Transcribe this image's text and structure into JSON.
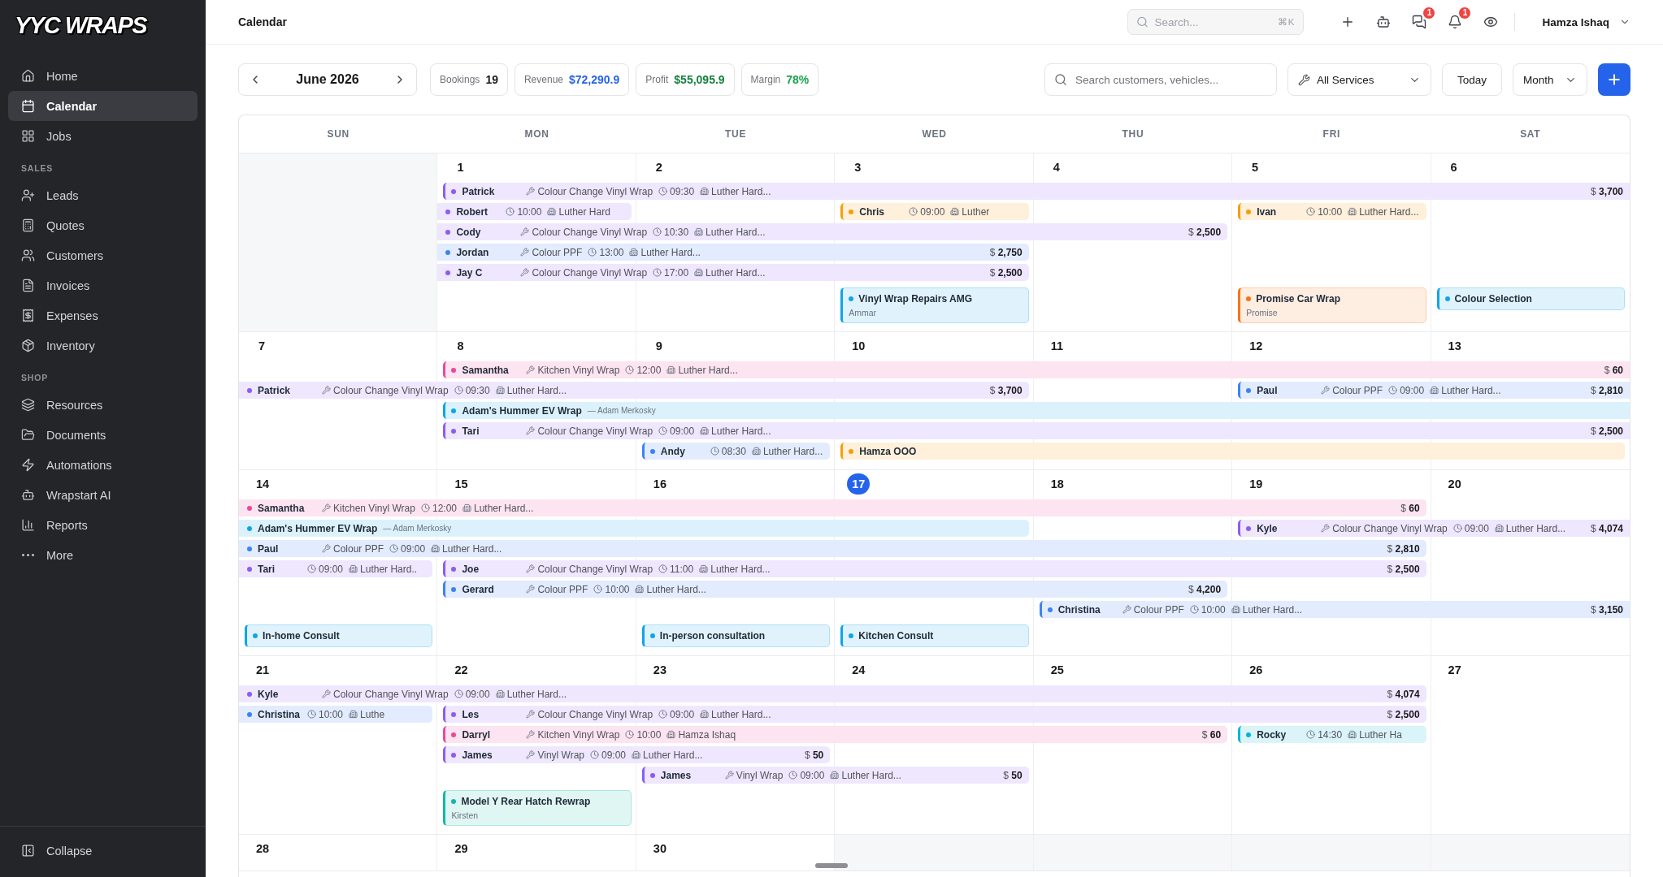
{
  "sidebar": {
    "logo": "YYC WRAPS",
    "sections": [
      {
        "items": [
          {
            "label": "Home",
            "selected": false
          },
          {
            "label": "Calendar",
            "selected": true
          },
          {
            "label": "Jobs",
            "selected": false
          }
        ]
      },
      {
        "title": "SALES",
        "items": [
          {
            "label": "Leads",
            "selected": false
          },
          {
            "label": "Quotes",
            "selected": false
          },
          {
            "label": "Customers",
            "selected": false
          },
          {
            "label": "Invoices",
            "selected": false
          },
          {
            "label": "Expenses",
            "selected": false
          },
          {
            "label": "Inventory",
            "selected": false
          }
        ]
      },
      {
        "title": "SHOP",
        "items": [
          {
            "label": "Resources",
            "selected": false
          },
          {
            "label": "Documents",
            "selected": false
          },
          {
            "label": "Automations",
            "selected": false
          },
          {
            "label": "Wrapstart AI",
            "selected": false
          },
          {
            "label": "Reports",
            "selected": false
          },
          {
            "label": "More",
            "selected": false
          }
        ]
      }
    ],
    "footer": {
      "label": "Collapse"
    }
  },
  "topbar": {
    "title": "Calendar",
    "search": {
      "placeholder": "Search...",
      "shortcut": "⌘K"
    },
    "messages_badge": "1",
    "notifications_badge": "1",
    "user": "Hamza Ishaq"
  },
  "toolbar": {
    "month": "June 2026",
    "stats": [
      {
        "label": "Bookings",
        "value": "19",
        "color": "#18181b"
      },
      {
        "label": "Revenue",
        "value": "$72,290.9",
        "color": "#2563eb"
      },
      {
        "label": "Profit",
        "value": "$55,095.9",
        "color": "#15803d"
      },
      {
        "label": "Margin",
        "value": "78%",
        "color": "#16a34a"
      }
    ],
    "search": {
      "placeholder": "Search customers, vehicles..."
    },
    "service_filter": "All Services",
    "today_button": "Today",
    "view": "Month"
  },
  "calendar": {
    "weekdays": [
      "SUN",
      "MON",
      "TUE",
      "WED",
      "THU",
      "FRI",
      "SAT"
    ],
    "weeks": [
      {
        "days": [
          {
            "kind": "outside"
          },
          {
            "kind": "day",
            "date": "1",
            "today": false
          },
          {
            "kind": "day",
            "date": "2",
            "today": false
          },
          {
            "kind": "day",
            "date": "3",
            "today": false,
            "cards": [
              {
                "title": "Vinyl Wrap Repairs AMG",
                "subtitle": "Ammar",
                "color": "#0ea5e9"
              }
            ]
          },
          {
            "kind": "day",
            "date": "4",
            "today": false
          },
          {
            "kind": "day",
            "date": "5",
            "today": false,
            "cards": [
              {
                "title": "Promise Car Wrap",
                "subtitle": "Promise",
                "color": "#f97316"
              }
            ]
          },
          {
            "kind": "day",
            "date": "6",
            "today": false,
            "cards": [
              {
                "title": "Colour Selection",
                "color": "#0ea5e9"
              }
            ]
          }
        ],
        "lanes": [
          {
            "slots": [
              {
                "kind": "empty"
              },
              {
                "kind": "booking",
                "name": "Patrick",
                "color": "#8b5cf6",
                "from_previous_week": false,
                "to_next_week": true,
                "service": "Colour Change Vinyl Wrap",
                "time": "09:30",
                "location": "Luther Hard...",
                "amount": "$ **3,700**"
              },
              {
                "kind": "continued"
              },
              {
                "kind": "continued"
              },
              {
                "kind": "continued"
              },
              {
                "kind": "continued"
              },
              {
                "kind": "continued"
              }
            ]
          },
          {
            "slots": [
              {
                "kind": "empty"
              },
              {
                "kind": "booking",
                "name": "Robert",
                "color": "#8b5cf6",
                "from_previous_week": true,
                "to_next_week": false,
                "time": "10:00",
                "location": "Luther Hard"
              },
              {
                "kind": "empty"
              },
              {
                "kind": "booking",
                "name": "Chris",
                "color": "#f59e0b",
                "from_previous_week": false,
                "to_next_week": false,
                "time": "09:00",
                "location": "Luther"
              },
              {
                "kind": "empty"
              },
              {
                "kind": "booking",
                "name": "Ivan",
                "color": "#f59e0b",
                "from_previous_week": false,
                "to_next_week": false,
                "time": "10:00",
                "location": "Luther Hard..."
              },
              {
                "kind": "empty"
              }
            ]
          },
          {
            "slots": [
              {
                "kind": "empty"
              },
              {
                "kind": "booking",
                "name": "Cody",
                "color": "#8b5cf6",
                "from_previous_week": true,
                "to_next_week": false,
                "service": "Colour Change Vinyl Wrap",
                "time": "10:30",
                "location": "Luther Hard...",
                "amount": "$ **2,500**"
              },
              {
                "kind": "continued"
              },
              {
                "kind": "continued"
              },
              {
                "kind": "continued"
              },
              {
                "kind": "empty"
              },
              {
                "kind": "empty"
              }
            ]
          },
          {
            "slots": [
              {
                "kind": "empty"
              },
              {
                "kind": "booking",
                "name": "Jordan",
                "color": "#3b82f6",
                "from_previous_week": true,
                "to_next_week": false,
                "service": "Colour PPF",
                "time": "13:00",
                "location": "Luther Hard...",
                "amount": "$ **2,750**"
              },
              {
                "kind": "continued"
              },
              {
                "kind": "continued"
              },
              {
                "kind": "empty"
              },
              {
                "kind": "empty"
              },
              {
                "kind": "empty"
              }
            ]
          },
          {
            "slots": [
              {
                "kind": "empty"
              },
              {
                "kind": "booking",
                "name": "Jay C",
                "color": "#8b5cf6",
                "from_previous_week": true,
                "to_next_week": false,
                "service": "Colour Change Vinyl Wrap",
                "time": "17:00",
                "location": "Luther Hard...",
                "amount": "$ **2,500**"
              },
              {
                "kind": "continued"
              },
              {
                "kind": "continued"
              },
              {
                "kind": "empty"
              },
              {
                "kind": "empty"
              },
              {
                "kind": "empty"
              }
            ]
          }
        ]
      },
      {
        "days": [
          {
            "kind": "day",
            "date": "7",
            "today": false
          },
          {
            "kind": "day",
            "date": "8",
            "today": false
          },
          {
            "kind": "day",
            "date": "9",
            "today": false
          },
          {
            "kind": "day",
            "date": "10",
            "today": false
          },
          {
            "kind": "day",
            "date": "11",
            "today": false
          },
          {
            "kind": "day",
            "date": "12",
            "today": false
          },
          {
            "kind": "day",
            "date": "13",
            "today": false
          }
        ],
        "lanes": [
          {
            "slots": [
              {
                "kind": "empty"
              },
              {
                "kind": "booking",
                "name": "Samantha",
                "color": "#ec4899",
                "from_previous_week": false,
                "to_next_week": true,
                "service": "Kitchen Vinyl Wrap",
                "time": "12:00",
                "location": "Luther Hard...",
                "amount": "$ **60**"
              },
              {
                "kind": "continued"
              },
              {
                "kind": "continued"
              },
              {
                "kind": "continued"
              },
              {
                "kind": "continued"
              },
              {
                "kind": "continued"
              }
            ]
          },
          {
            "slots": [
              {
                "kind": "booking",
                "name": "Patrick",
                "color": "#8b5cf6",
                "from_previous_week": true,
                "to_next_week": false,
                "service": "Colour Change Vinyl Wrap",
                "time": "09:30",
                "location": "Luther Hard...",
                "amount": "$ **3,700**"
              },
              {
                "kind": "continued"
              },
              {
                "kind": "continued"
              },
              {
                "kind": "continued"
              },
              {
                "kind": "empty"
              },
              {
                "kind": "booking",
                "name": "Paul",
                "color": "#3b82f6",
                "from_previous_week": false,
                "to_next_week": true,
                "service": "Colour PPF",
                "time": "09:00",
                "location": "Luther Hard...",
                "amount": "$ **2,810**"
              },
              {
                "kind": "continued"
              }
            ]
          },
          {
            "slots": [
              {
                "kind": "empty"
              },
              {
                "kind": "project",
                "name": "Adam's Hummer EV Wrap",
                "note": "— Adam Merkosky",
                "color": "#0ea5e9",
                "from_previous_week": false,
                "to_next_week": true
              },
              {
                "kind": "continued"
              },
              {
                "kind": "continued"
              },
              {
                "kind": "continued"
              },
              {
                "kind": "continued"
              },
              {
                "kind": "continued"
              }
            ]
          },
          {
            "slots": [
              {
                "kind": "empty"
              },
              {
                "kind": "booking",
                "name": "Tari",
                "color": "#8b5cf6",
                "from_previous_week": false,
                "to_next_week": true,
                "service": "Colour Change Vinyl Wrap",
                "time": "09:00",
                "location": "Luther Hard...",
                "amount": "$ **2,500**"
              },
              {
                "kind": "continued"
              },
              {
                "kind": "continued"
              },
              {
                "kind": "continued"
              },
              {
                "kind": "continued"
              },
              {
                "kind": "continued"
              }
            ]
          },
          {
            "slots": [
              {
                "kind": "empty"
              },
              {
                "kind": "empty"
              },
              {
                "kind": "booking",
                "name": "Andy",
                "color": "#3b82f6",
                "from_previous_week": false,
                "to_next_week": false,
                "time": "08:30",
                "location": "Luther Hard..."
              },
              {
                "kind": "booking",
                "name": "Hamza OOO",
                "color": "#f59e0b",
                "from_previous_week": false,
                "to_next_week": false
              },
              {
                "kind": "continued"
              },
              {
                "kind": "continued"
              },
              {
                "kind": "continued"
              }
            ]
          }
        ]
      },
      {
        "days": [
          {
            "kind": "day",
            "date": "14",
            "today": false,
            "cards": [
              {
                "title": "In-home Consult",
                "color": "#0ea5e9"
              }
            ]
          },
          {
            "kind": "day",
            "date": "15",
            "today": false
          },
          {
            "kind": "day",
            "date": "16",
            "today": false,
            "cards": [
              {
                "title": "In-person consultation",
                "color": "#0ea5e9"
              }
            ]
          },
          {
            "kind": "day",
            "date": "17",
            "today": true,
            "cards": [
              {
                "title": "Kitchen Consult",
                "color": "#0ea5e9"
              }
            ]
          },
          {
            "kind": "day",
            "date": "18",
            "today": false
          },
          {
            "kind": "day",
            "date": "19",
            "today": false
          },
          {
            "kind": "day",
            "date": "20",
            "today": false
          }
        ],
        "lanes": [
          {
            "slots": [
              {
                "kind": "booking",
                "name": "Samantha",
                "color": "#ec4899",
                "from_previous_week": true,
                "to_next_week": false,
                "service": "Kitchen Vinyl Wrap",
                "time": "12:00",
                "location": "Luther Hard...",
                "amount": "$ **60**"
              },
              {
                "kind": "continued"
              },
              {
                "kind": "continued"
              },
              {
                "kind": "continued"
              },
              {
                "kind": "continued"
              },
              {
                "kind": "continued"
              },
              {
                "kind": "empty"
              }
            ]
          },
          {
            "slots": [
              {
                "kind": "project",
                "name": "Adam's Hummer EV Wrap",
                "note": "— Adam Merkosky",
                "color": "#0ea5e9",
                "from_previous_week": true,
                "to_next_week": false
              },
              {
                "kind": "continued"
              },
              {
                "kind": "continued"
              },
              {
                "kind": "continued"
              },
              {
                "kind": "empty"
              },
              {
                "kind": "booking",
                "name": "Kyle",
                "color": "#8b5cf6",
                "from_previous_week": false,
                "to_next_week": true,
                "service": "Colour Change Vinyl Wrap",
                "time": "09:00",
                "location": "Luther Hard...",
                "amount": "$ **4,074**"
              },
              {
                "kind": "continued"
              }
            ]
          },
          {
            "slots": [
              {
                "kind": "booking",
                "name": "Paul",
                "color": "#3b82f6",
                "from_previous_week": true,
                "to_next_week": false,
                "service": "Colour PPF",
                "time": "09:00",
                "location": "Luther Hard...",
                "amount": "$ **2,810**"
              },
              {
                "kind": "continued"
              },
              {
                "kind": "continued"
              },
              {
                "kind": "continued"
              },
              {
                "kind": "continued"
              },
              {
                "kind": "continued"
              },
              {
                "kind": "empty"
              }
            ]
          },
          {
            "slots": [
              {
                "kind": "booking",
                "name": "Tari",
                "color": "#8b5cf6",
                "from_previous_week": true,
                "to_next_week": false,
                "time": "09:00",
                "location": "Luther Hard.."
              },
              {
                "kind": "booking",
                "name": "Joe",
                "color": "#8b5cf6",
                "from_previous_week": false,
                "to_next_week": false,
                "service": "Colour Change Vinyl Wrap",
                "time": "11:00",
                "location": "Luther Hard...",
                "amount": "$ **2,500**"
              },
              {
                "kind": "continued"
              },
              {
                "kind": "continued"
              },
              {
                "kind": "continued"
              },
              {
                "kind": "continued"
              },
              {
                "kind": "empty"
              }
            ]
          },
          {
            "slots": [
              {
                "kind": "empty"
              },
              {
                "kind": "booking",
                "name": "Gerard",
                "color": "#3b82f6",
                "from_previous_week": false,
                "to_next_week": false,
                "service": "Colour PPF",
                "time": "10:00",
                "location": "Luther Hard...",
                "amount": "$ **4,200**"
              },
              {
                "kind": "continued"
              },
              {
                "kind": "continued"
              },
              {
                "kind": "continued"
              },
              {
                "kind": "empty"
              },
              {
                "kind": "empty"
              }
            ]
          },
          {
            "slots": [
              {
                "kind": "empty"
              },
              {
                "kind": "empty"
              },
              {
                "kind": "empty"
              },
              {
                "kind": "empty"
              },
              {
                "kind": "booking",
                "name": "Christina",
                "color": "#3b82f6",
                "from_previous_week": false,
                "to_next_week": true,
                "service": "Colour PPF",
                "time": "10:00",
                "location": "Luther Hard...",
                "amount": "$ **3,150**"
              },
              {
                "kind": "continued"
              },
              {
                "kind": "continued"
              }
            ]
          }
        ]
      },
      {
        "days": [
          {
            "kind": "day",
            "date": "21",
            "today": false
          },
          {
            "kind": "day",
            "date": "22",
            "today": false,
            "cards": [
              {
                "title": "Model Y Rear Hatch Rewrap",
                "subtitle": "Kirsten",
                "color": "#14b8a6"
              }
            ]
          },
          {
            "kind": "day",
            "date": "23",
            "today": false
          },
          {
            "kind": "day",
            "date": "24",
            "today": false
          },
          {
            "kind": "day",
            "date": "25",
            "today": false
          },
          {
            "kind": "day",
            "date": "26",
            "today": false
          },
          {
            "kind": "day",
            "date": "27",
            "today": false
          }
        ],
        "lanes": [
          {
            "slots": [
              {
                "kind": "booking",
                "name": "Kyle",
                "color": "#8b5cf6",
                "from_previous_week": true,
                "to_next_week": false,
                "service": "Colour Change Vinyl Wrap",
                "time": "09:00",
                "location": "Luther Hard...",
                "amount": "$ **4,074**"
              },
              {
                "kind": "continued"
              },
              {
                "kind": "continued"
              },
              {
                "kind": "continued"
              },
              {
                "kind": "continued"
              },
              {
                "kind": "continued"
              },
              {
                "kind": "empty"
              }
            ]
          },
          {
            "slots": [
              {
                "kind": "booking",
                "name": "Christina",
                "color": "#3b82f6",
                "from_previous_week": true,
                "to_next_week": false,
                "time": "10:00",
                "location": "Luthe"
              },
              {
                "kind": "booking",
                "name": "Les",
                "color": "#8b5cf6",
                "from_previous_week": false,
                "to_next_week": false,
                "service": "Colour Change Vinyl Wrap",
                "time": "09:00",
                "location": "Luther Hard...",
                "amount": "$ **2,500**"
              },
              {
                "kind": "continued"
              },
              {
                "kind": "continued"
              },
              {
                "kind": "continued"
              },
              {
                "kind": "continued"
              },
              {
                "kind": "empty"
              }
            ]
          },
          {
            "slots": [
              {
                "kind": "empty"
              },
              {
                "kind": "booking",
                "name": "Darryl",
                "color": "#ec4899",
                "from_previous_week": false,
                "to_next_week": false,
                "service": "Kitchen Vinyl Wrap",
                "time": "10:00",
                "location": "Hamza Ishaq",
                "amount": "$ **60**"
              },
              {
                "kind": "continued"
              },
              {
                "kind": "continued"
              },
              {
                "kind": "continued"
              },
              {
                "kind": "booking",
                "name": "Rocky",
                "color": "#06b6d4",
                "from_previous_week": false,
                "to_next_week": false,
                "time": "14:30",
                "location": "Luther Ha"
              },
              {
                "kind": "empty"
              }
            ]
          },
          {
            "slots": [
              {
                "kind": "empty"
              },
              {
                "kind": "booking",
                "name": "James",
                "color": "#8b5cf6",
                "from_previous_week": false,
                "to_next_week": false,
                "service": "Vinyl Wrap",
                "time": "09:00",
                "location": "Luther Hard...",
                "amount": "$ **50**"
              },
              {
                "kind": "continued"
              },
              {
                "kind": "empty"
              },
              {
                "kind": "empty"
              },
              {
                "kind": "empty"
              },
              {
                "kind": "empty"
              }
            ]
          },
          {
            "slots": [
              {
                "kind": "empty"
              },
              {
                "kind": "empty"
              },
              {
                "kind": "booking",
                "name": "James",
                "color": "#8b5cf6",
                "from_previous_week": false,
                "to_next_week": false,
                "service": "Vinyl Wrap",
                "time": "09:00",
                "location": "Luther Hard...",
                "amount": "$ **50**"
              },
              {
                "kind": "continued"
              },
              {
                "kind": "empty"
              },
              {
                "kind": "empty"
              },
              {
                "kind": "empty"
              }
            ]
          }
        ]
      },
      {
        "days": [
          {
            "kind": "day",
            "date": "28",
            "today": false
          },
          {
            "kind": "day",
            "date": "29",
            "today": false
          },
          {
            "kind": "day",
            "date": "30",
            "today": false
          },
          {
            "kind": "outside"
          },
          {
            "kind": "outside"
          },
          {
            "kind": "outside"
          },
          {
            "kind": "outside"
          }
        ]
      }
    ]
  }
}
